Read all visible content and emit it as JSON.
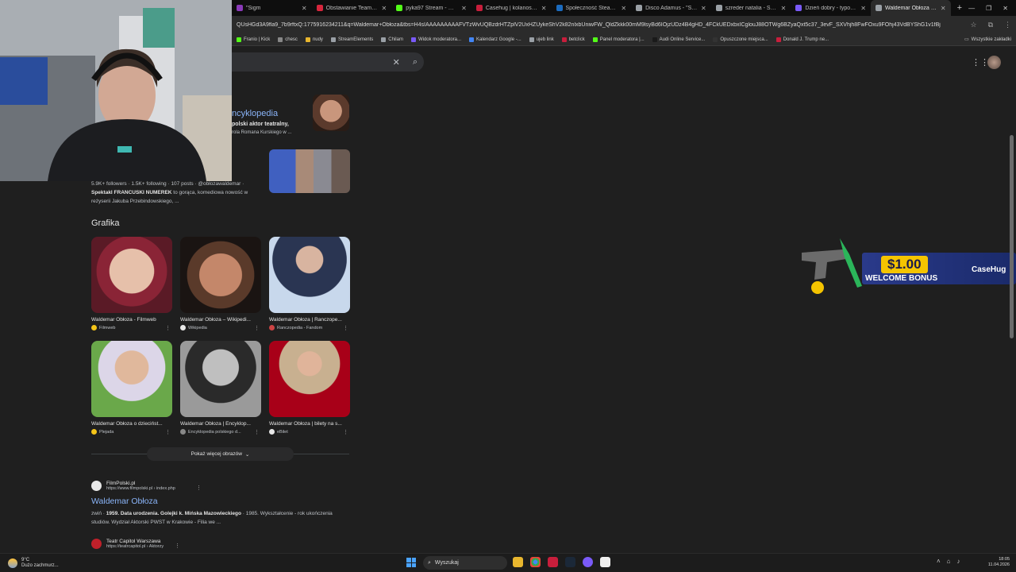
{
  "tabs": [
    {
      "title": "\"Sigm",
      "favicon": "#8a3ab9",
      "active": false
    },
    {
      "title": "Obstawianie Team Franio",
      "favicon": "#d7263d",
      "active": false
    },
    {
      "title": "pyka97 Stream - Watch Li",
      "favicon": "#53fc18",
      "active": false
    },
    {
      "title": "Casehug | kolanoskopia",
      "favicon": "#c81e3c",
      "active": false
    },
    {
      "title": "Społeczność Steam :: kola",
      "favicon": "#1b6bbf",
      "active": false
    },
    {
      "title": "Disco Adamus - \"Sigma B",
      "favicon": "#9aa0a6",
      "active": false
    },
    {
      "title": "szreder natalia - Szukaj w",
      "favicon": "#9aa0a6",
      "active": false
    },
    {
      "title": "Dzień dobry - typowy str",
      "favicon": "#7a5af8",
      "active": false
    },
    {
      "title": "Waldemar Obłoza - Szuk",
      "favicon": "#9aa0a6",
      "active": true
    }
  ],
  "address": {
    "url": "QUsHGd3A9fla9_7b9rftxQ:1775916234211&q=Waldemar+Obłoza&tbs=H4sIAAAAAAAAAFVTzWvUQBzdrHTZplV2UxHZUykeShV2k82nlxbUniwFW_QldZkkk00mM9lsyBd6IOjzUDz4B4gHD_4FCkUEDxbxICglouJ88OTWg6BZyaQxt5c37_3evF_SXVhjh8FwFOxu9FOhj43VdBYShG1v1fBj"
  },
  "bookmarks": [
    "Franio | Kick",
    "chesc",
    "nudy",
    "StreamElements",
    "Chilam",
    "Widok moderatora...",
    "Kalendarz Google -...",
    "ujeb link",
    "betclick",
    "Panel moderatora |...",
    "Audi Online Service...",
    "Opuszczone miejsca...",
    "Donald J. Trump ne..."
  ],
  "all_bookmarks": "Wszystkie zakładki",
  "wiki": {
    "title": "ncyklopedia",
    "desc1": "polski aktor teatralny,",
    "desc2": "rola Romana Kurskiego w ..."
  },
  "ig_snippet": {
    "line1": "5.9K+ followers · 1.5K+ following · 107 posts · @obłozawaldemar ·",
    "bold": "Spektakl FRANCUSKI NUMEREK",
    "line2": " to gorąca, komediowa nowość w",
    "line3": "reżyserii Jakuba Przebindowskiego, ..."
  },
  "section_title": "Grafika",
  "images": [
    {
      "caption": "Waldemar Obłoza - Filmweb",
      "source": "Filmweb",
      "src_color": "#f5c518"
    },
    {
      "caption": "Waldemar Obłoza – Wikipedi...",
      "source": "Wikipedia",
      "src_color": "#e8e8e8"
    },
    {
      "caption": "Waldemar Obłoza | Ranczope...",
      "source": "Ranczopedia - Fandom",
      "src_color": "#c44"
    },
    {
      "caption": "Waldemar Obłoza o dziecińst...",
      "source": "Plejada",
      "src_color": "#f5c518"
    },
    {
      "caption": "Waldemar Obłoza | Encyklop...",
      "source": "Encyklopedia polskiego d...",
      "src_color": "#888"
    },
    {
      "caption": "Waldemar Obłoza | bilety na s...",
      "source": "eBilet",
      "src_color": "#e8e8e8"
    }
  ],
  "show_more": "Pokaż więcej obrazów",
  "result1": {
    "site": "FilmPolski.pl",
    "url": "https://www.filmpolski.pl › index.php",
    "title": "Waldemar Obłoza",
    "snip_pre": "zwiń · ",
    "snip_bold": "1959. Data urodzenia. Golejki k. Mińska Mazowieckiego",
    "snip_post": " · 1985. Wykształcenie - rok ukończenia studiów. Wydział Aktorski PWST w Krakowie - Filia we ..."
  },
  "result2": {
    "site": "Teatr Capitol Warszawa",
    "url": "https://teatrcapitol.pl › Aktorzy"
  },
  "ad": {
    "price": "$1.00",
    "bonus": "WELCOME BONUS",
    "brand": "CaseHug"
  },
  "taskbar": {
    "temp": "9°C",
    "weather": "Dużo zachmurz...",
    "search": "Wyszukaj",
    "time": "18:05",
    "date": "11.04.2026"
  }
}
